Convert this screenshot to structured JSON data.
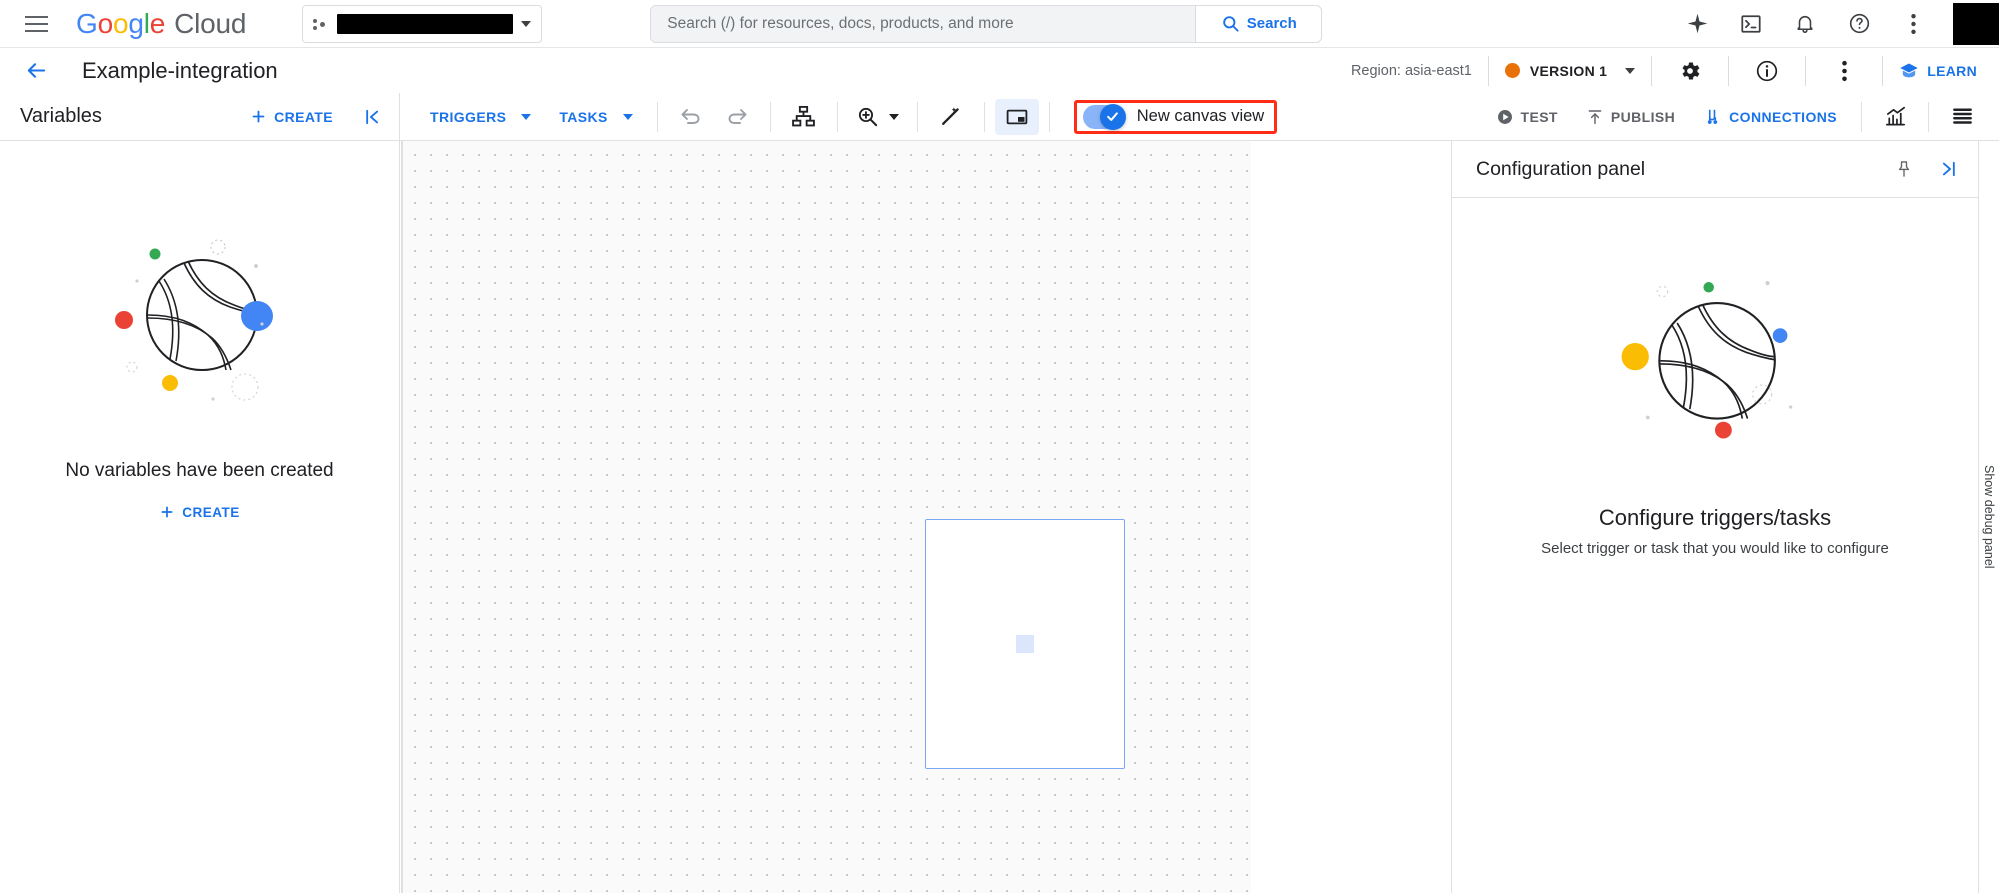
{
  "header": {
    "menu_icon": "hamburger-menu-icon",
    "brand": {
      "google": "Google",
      "cloud": "Cloud"
    },
    "project_selector": {
      "value": "",
      "caret": "chevron-down-icon"
    },
    "search": {
      "placeholder": "Search (/) for resources, docs, products, and more",
      "value": "",
      "button_label": "Search",
      "button_icon": "search-icon"
    },
    "right_icons": [
      {
        "name": "gemini-sparkle-icon",
        "label": "Gemini"
      },
      {
        "name": "cloud-shell-icon",
        "label": "Activate Cloud Shell"
      },
      {
        "name": "notifications-bell-icon",
        "label": "Notifications"
      },
      {
        "name": "help-question-icon",
        "label": "Help"
      },
      {
        "name": "more-vert-icon",
        "label": "More options"
      }
    ],
    "avatar": {
      "name": "account-avatar",
      "label": ""
    }
  },
  "titlebar": {
    "back_icon": "arrow-back-icon",
    "title": "Example-integration",
    "region": "Region: asia-east1",
    "version": {
      "label": "VERSION 1",
      "status_color": "#E8710A",
      "caret": "chevron-down-icon"
    },
    "settings_icon": "gear-icon",
    "info_icon": "info-circle-icon",
    "more_icon": "more-vert-icon",
    "learn": {
      "label": "LEARN",
      "icon": "school-icon"
    }
  },
  "toolbar": {
    "variables_label": "Variables",
    "variables_create": "CREATE",
    "collapse_icon": "collapse-left-icon",
    "triggers": "TRIGGERS",
    "tasks": "TASKS",
    "undo_icon": "undo-icon",
    "redo_icon": "redo-icon",
    "layout_icon": "auto-layout-icon",
    "zoom_icon": "zoom-in-icon",
    "magic_icon": "magic-wand-icon",
    "panel_icon": "toggle-panel-icon",
    "canvas_toggle": {
      "label": "New canvas view",
      "checked": true,
      "highlight_color": "#FF2D16"
    },
    "test": {
      "label": "TEST",
      "icon": "play-circle-icon"
    },
    "publish": {
      "label": "PUBLISH",
      "icon": "publish-upload-icon"
    },
    "connections": {
      "label": "CONNECTIONS",
      "icon": "connections-icon"
    },
    "metrics_icon": "chart-metrics-icon",
    "logs_icon": "logs-list-icon"
  },
  "variables_panel": {
    "empty_title": "No variables have been created",
    "empty_create": "CREATE",
    "illustration": {
      "name": "empty-state-sphere-illustration",
      "dot_green": "#34A853",
      "dot_red": "#EA4335",
      "dot_blue": "#4285F4",
      "dot_yellow": "#FBBC04"
    }
  },
  "canvas": {
    "name": "integration-canvas",
    "card": {
      "name": "canvas-node-card",
      "placeholder": ""
    }
  },
  "config_panel": {
    "title": "Configuration panel",
    "pin_icon": "pin-icon",
    "collapse_icon": "collapse-right-icon",
    "empty_title": "Configure triggers/tasks",
    "empty_sub": "Select trigger or task that you would like to configure",
    "illustration": {
      "name": "empty-state-sphere-illustration"
    }
  },
  "debug_rail": {
    "label": "Show debug panel"
  }
}
